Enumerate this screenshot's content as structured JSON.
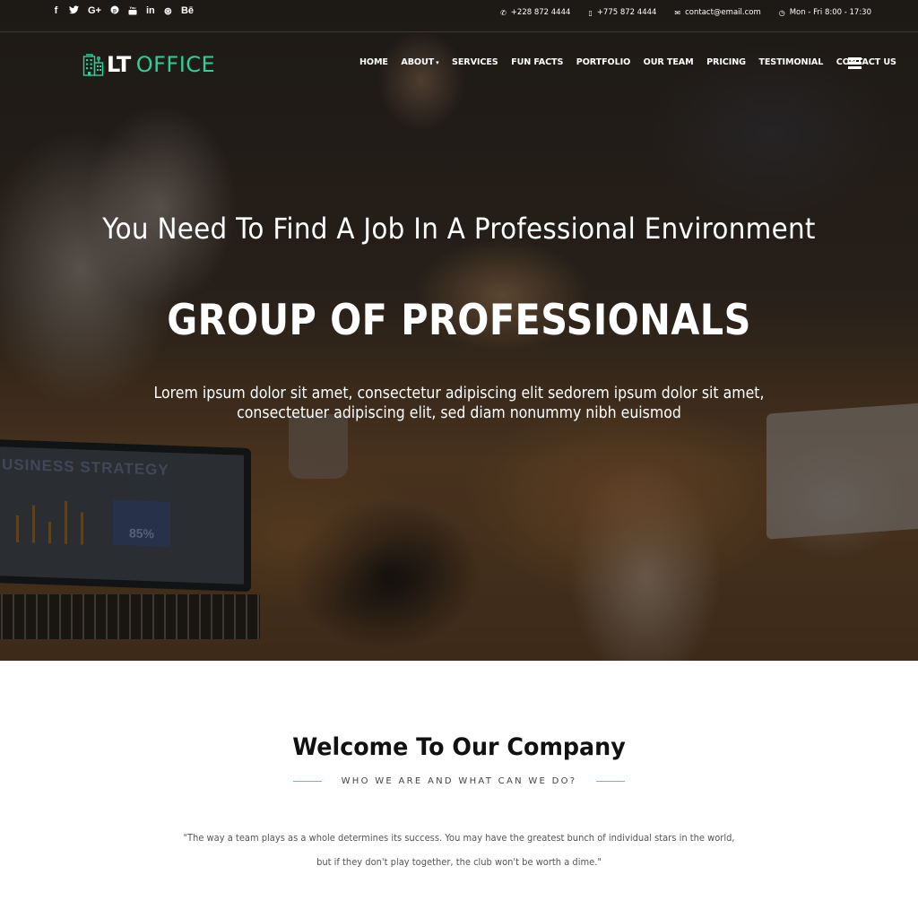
{
  "topbar": {
    "social": [
      {
        "name": "facebook-icon",
        "glyph": "f"
      },
      {
        "name": "twitter-icon",
        "glyph": "🐦"
      },
      {
        "name": "google-plus-icon",
        "glyph": "G+"
      },
      {
        "name": "pinterest-icon",
        "glyph": "℗"
      },
      {
        "name": "youtube-icon",
        "glyph": "▶"
      },
      {
        "name": "linkedin-icon",
        "glyph": "in"
      },
      {
        "name": "dribbble-icon",
        "glyph": "⊛"
      },
      {
        "name": "behance-icon",
        "glyph": "Bē"
      }
    ],
    "phone1": "+228 872 4444",
    "phone2": "+775 872 4444",
    "email": "contact@email.com",
    "hours": "Mon - Fri 8:00 - 17:30",
    "icons": {
      "phone": "✆",
      "mobile": "▯",
      "email": "✉",
      "clock": "◷"
    }
  },
  "logo": {
    "part1": "LT",
    "part2": "OFFICE",
    "accent": "#2ecf9a"
  },
  "nav": {
    "items": [
      "HOME",
      "ABOUT",
      "SERVICES",
      "FUN FACTS",
      "PORTFOLIO",
      "OUR TEAM",
      "PRICING",
      "TESTIMONIAL",
      "CONTACT US"
    ],
    "about_caret": "⌄"
  },
  "hero": {
    "subtitle": "You Need To Find A Job In A Professional Environment",
    "title": "GROUP OF PROFESSIONALS",
    "desc_line1": "Lorem ipsum dolor sit amet, consectetur adipiscing elit sedorem ipsum dolor sit amet,",
    "desc_line2": "consectetuer adipiscing elit, sed diam nonummy nibh euismod",
    "image_laptop_text": "USINESS STRATEGY",
    "image_laptop_stat": "85%"
  },
  "welcome": {
    "title": "Welcome To Our Company",
    "subtitle": "WHO WE ARE AND WHAT CAN WE DO?",
    "quote_line1": "\"The way a team plays as a whole determines its success. You may have the greatest bunch of individual stars in the world,",
    "quote_line2": "but if they don't play together, the club won't be worth a dime.\""
  }
}
